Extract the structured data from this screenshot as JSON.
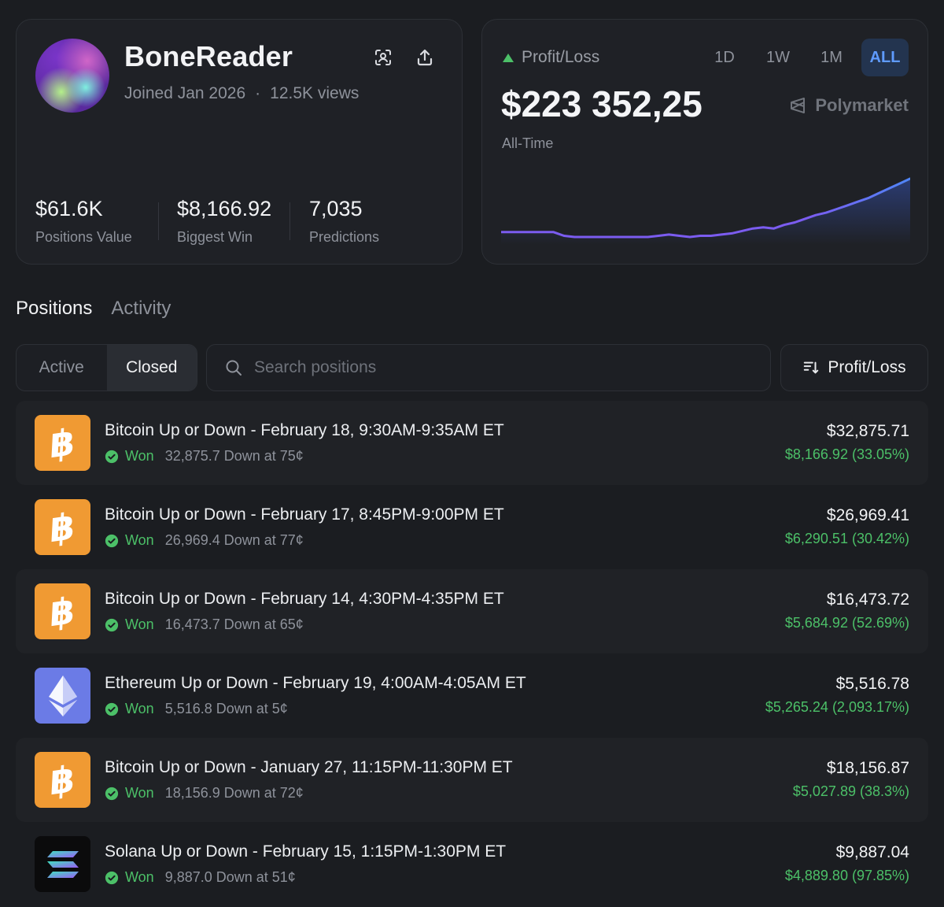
{
  "profile": {
    "username": "BoneReader",
    "joined": "Joined Jan 2026",
    "views": "12.5K views",
    "stats": [
      {
        "value": "$61.6K",
        "label": "Positions Value"
      },
      {
        "value": "$8,166.92",
        "label": "Biggest Win"
      },
      {
        "value": "7,035",
        "label": "Predictions"
      }
    ]
  },
  "pnl": {
    "label": "Profit/Loss",
    "value": "$223 352,25",
    "period": "All-Time",
    "brand": "Polymarket",
    "ranges": [
      "1D",
      "1W",
      "1M",
      "ALL"
    ],
    "active_range": "ALL",
    "accent_color": "#7b5cf0",
    "up_color": "#4cc068"
  },
  "chart_data": {
    "type": "area",
    "x": [
      0,
      1,
      2,
      3,
      4,
      5,
      6,
      7,
      8,
      9,
      10,
      11,
      12,
      13,
      14,
      15,
      16,
      17,
      18,
      19,
      20,
      21,
      22,
      23,
      24,
      25,
      26,
      27,
      28,
      29,
      30,
      31,
      32,
      33,
      34,
      35,
      36,
      37,
      38,
      39
    ],
    "values": [
      0,
      0,
      0,
      0,
      0,
      0,
      -3,
      -4,
      -4,
      -4,
      -4,
      -4,
      -4,
      -4,
      -4,
      -3,
      -2,
      -3,
      -4,
      -3,
      -3,
      -2,
      -1,
      1,
      3,
      4,
      3,
      6,
      8,
      11,
      14,
      16,
      19,
      22,
      25,
      28,
      32,
      36,
      40,
      44
    ],
    "title": "",
    "xlabel": "",
    "ylabel": ""
  },
  "tabs": {
    "section": [
      "Positions",
      "Activity"
    ],
    "active_section": "Positions",
    "filter": [
      "Active",
      "Closed"
    ],
    "active_filter": "Closed"
  },
  "search": {
    "placeholder": "Search positions"
  },
  "sort": {
    "label": "Profit/Loss"
  },
  "positions": [
    {
      "coin": "btc",
      "title": "Bitcoin Up or Down - February 18, 9:30AM-9:35AM ET",
      "status": "Won",
      "detail": "32,875.7 Down at 75¢",
      "amount": "$32,875.71",
      "gain": "$8,166.92 (33.05%)"
    },
    {
      "coin": "btc",
      "title": "Bitcoin Up or Down - February 17, 8:45PM-9:00PM ET",
      "status": "Won",
      "detail": "26,969.4 Down at 77¢",
      "amount": "$26,969.41",
      "gain": "$6,290.51 (30.42%)"
    },
    {
      "coin": "btc",
      "title": "Bitcoin Up or Down - February 14, 4:30PM-4:35PM ET",
      "status": "Won",
      "detail": "16,473.7 Down at 65¢",
      "amount": "$16,473.72",
      "gain": "$5,684.92 (52.69%)"
    },
    {
      "coin": "eth",
      "title": "Ethereum Up or Down - February 19, 4:00AM-4:05AM ET",
      "status": "Won",
      "detail": "5,516.8 Down at 5¢",
      "amount": "$5,516.78",
      "gain": "$5,265.24 (2,093.17%)"
    },
    {
      "coin": "btc",
      "title": "Bitcoin Up or Down - January 27, 11:15PM-11:30PM ET",
      "status": "Won",
      "detail": "18,156.9 Down at 72¢",
      "amount": "$18,156.87",
      "gain": "$5,027.89 (38.3%)"
    },
    {
      "coin": "sol",
      "title": "Solana Up or Down - February 15, 1:15PM-1:30PM ET",
      "status": "Won",
      "detail": "9,887.0 Down at 51¢",
      "amount": "$9,887.04",
      "gain": "$4,889.80 (97.85%)"
    }
  ]
}
